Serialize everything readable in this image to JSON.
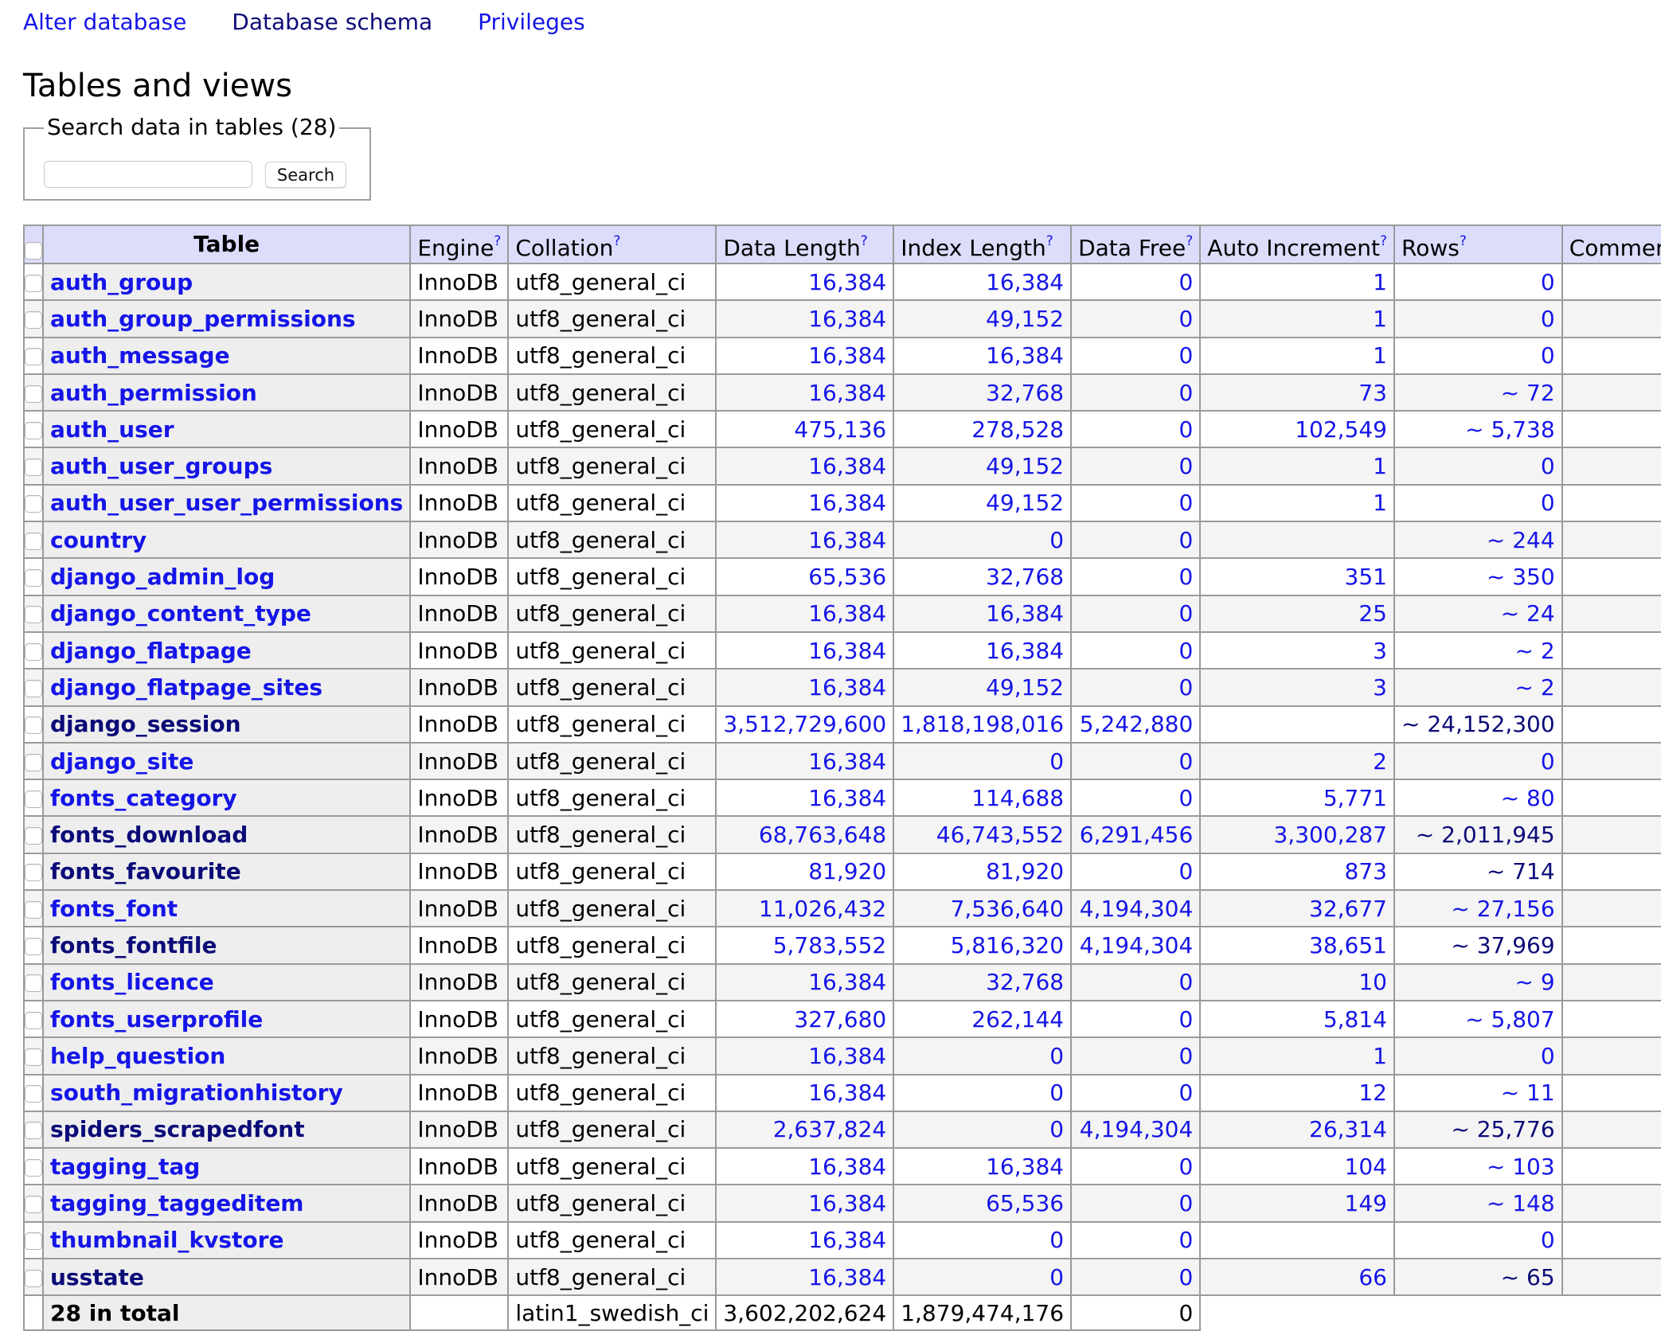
{
  "nav": {
    "links": [
      {
        "label": "Alter database",
        "visited": false
      },
      {
        "label": "Database schema",
        "visited": true
      },
      {
        "label": "Privileges",
        "visited": false
      }
    ]
  },
  "page_title": "Tables and views",
  "search": {
    "legend": "Search data in tables (28)",
    "input_value": "",
    "button_label": "Search"
  },
  "table": {
    "help_marker": "?",
    "columns": [
      {
        "label": "Table",
        "help": false
      },
      {
        "label": "Engine",
        "help": true
      },
      {
        "label": "Collation",
        "help": true
      },
      {
        "label": "Data Length",
        "help": true
      },
      {
        "label": "Index Length",
        "help": true
      },
      {
        "label": "Data Free",
        "help": true
      },
      {
        "label": "Auto Increment",
        "help": true
      },
      {
        "label": "Rows",
        "help": true
      },
      {
        "label": "Comment",
        "help": true
      }
    ],
    "rows": [
      {
        "name": "auth_group",
        "visited": false,
        "engine": "InnoDB",
        "collation": "utf8_general_ci",
        "data_length": "16,384",
        "index_length": "16,384",
        "data_free": "0",
        "auto_increment": "1",
        "rows": "0",
        "comment": ""
      },
      {
        "name": "auth_group_permissions",
        "visited": false,
        "engine": "InnoDB",
        "collation": "utf8_general_ci",
        "data_length": "16,384",
        "index_length": "49,152",
        "data_free": "0",
        "auto_increment": "1",
        "rows": "0",
        "comment": ""
      },
      {
        "name": "auth_message",
        "visited": false,
        "engine": "InnoDB",
        "collation": "utf8_general_ci",
        "data_length": "16,384",
        "index_length": "16,384",
        "data_free": "0",
        "auto_increment": "1",
        "rows": "0",
        "comment": ""
      },
      {
        "name": "auth_permission",
        "visited": false,
        "engine": "InnoDB",
        "collation": "utf8_general_ci",
        "data_length": "16,384",
        "index_length": "32,768",
        "data_free": "0",
        "auto_increment": "73",
        "rows": "~ 72",
        "comment": ""
      },
      {
        "name": "auth_user",
        "visited": false,
        "engine": "InnoDB",
        "collation": "utf8_general_ci",
        "data_length": "475,136",
        "index_length": "278,528",
        "data_free": "0",
        "auto_increment": "102,549",
        "rows": "~ 5,738",
        "comment": ""
      },
      {
        "name": "auth_user_groups",
        "visited": false,
        "engine": "InnoDB",
        "collation": "utf8_general_ci",
        "data_length": "16,384",
        "index_length": "49,152",
        "data_free": "0",
        "auto_increment": "1",
        "rows": "0",
        "comment": ""
      },
      {
        "name": "auth_user_user_permissions",
        "visited": false,
        "engine": "InnoDB",
        "collation": "utf8_general_ci",
        "data_length": "16,384",
        "index_length": "49,152",
        "data_free": "0",
        "auto_increment": "1",
        "rows": "0",
        "comment": ""
      },
      {
        "name": "country",
        "visited": false,
        "engine": "InnoDB",
        "collation": "utf8_general_ci",
        "data_length": "16,384",
        "index_length": "0",
        "data_free": "0",
        "auto_increment": "",
        "rows": "~ 244",
        "comment": ""
      },
      {
        "name": "django_admin_log",
        "visited": false,
        "engine": "InnoDB",
        "collation": "utf8_general_ci",
        "data_length": "65,536",
        "index_length": "32,768",
        "data_free": "0",
        "auto_increment": "351",
        "rows": "~ 350",
        "comment": ""
      },
      {
        "name": "django_content_type",
        "visited": false,
        "engine": "InnoDB",
        "collation": "utf8_general_ci",
        "data_length": "16,384",
        "index_length": "16,384",
        "data_free": "0",
        "auto_increment": "25",
        "rows": "~ 24",
        "comment": ""
      },
      {
        "name": "django_flatpage",
        "visited": false,
        "engine": "InnoDB",
        "collation": "utf8_general_ci",
        "data_length": "16,384",
        "index_length": "16,384",
        "data_free": "0",
        "auto_increment": "3",
        "rows": "~ 2",
        "comment": ""
      },
      {
        "name": "django_flatpage_sites",
        "visited": false,
        "engine": "InnoDB",
        "collation": "utf8_general_ci",
        "data_length": "16,384",
        "index_length": "49,152",
        "data_free": "0",
        "auto_increment": "3",
        "rows": "~ 2",
        "comment": ""
      },
      {
        "name": "django_session",
        "visited": true,
        "engine": "InnoDB",
        "collation": "utf8_general_ci",
        "data_length": "3,512,729,600",
        "index_length": "1,818,198,016",
        "data_free": "5,242,880",
        "auto_increment": "",
        "rows": "~ 24,152,300",
        "comment": ""
      },
      {
        "name": "django_site",
        "visited": false,
        "engine": "InnoDB",
        "collation": "utf8_general_ci",
        "data_length": "16,384",
        "index_length": "0",
        "data_free": "0",
        "auto_increment": "2",
        "rows": "0",
        "comment": ""
      },
      {
        "name": "fonts_category",
        "visited": false,
        "engine": "InnoDB",
        "collation": "utf8_general_ci",
        "data_length": "16,384",
        "index_length": "114,688",
        "data_free": "0",
        "auto_increment": "5,771",
        "rows": "~ 80",
        "comment": ""
      },
      {
        "name": "fonts_download",
        "visited": true,
        "engine": "InnoDB",
        "collation": "utf8_general_ci",
        "data_length": "68,763,648",
        "index_length": "46,743,552",
        "data_free": "6,291,456",
        "auto_increment": "3,300,287",
        "rows": "~ 2,011,945",
        "comment": ""
      },
      {
        "name": "fonts_favourite",
        "visited": true,
        "engine": "InnoDB",
        "collation": "utf8_general_ci",
        "data_length": "81,920",
        "index_length": "81,920",
        "data_free": "0",
        "auto_increment": "873",
        "rows": "~ 714",
        "comment": ""
      },
      {
        "name": "fonts_font",
        "visited": false,
        "engine": "InnoDB",
        "collation": "utf8_general_ci",
        "data_length": "11,026,432",
        "index_length": "7,536,640",
        "data_free": "4,194,304",
        "auto_increment": "32,677",
        "rows": "~ 27,156",
        "comment": ""
      },
      {
        "name": "fonts_fontfile",
        "visited": true,
        "engine": "InnoDB",
        "collation": "utf8_general_ci",
        "data_length": "5,783,552",
        "index_length": "5,816,320",
        "data_free": "4,194,304",
        "auto_increment": "38,651",
        "rows": "~ 37,969",
        "comment": ""
      },
      {
        "name": "fonts_licence",
        "visited": false,
        "engine": "InnoDB",
        "collation": "utf8_general_ci",
        "data_length": "16,384",
        "index_length": "32,768",
        "data_free": "0",
        "auto_increment": "10",
        "rows": "~ 9",
        "comment": ""
      },
      {
        "name": "fonts_userprofile",
        "visited": false,
        "engine": "InnoDB",
        "collation": "utf8_general_ci",
        "data_length": "327,680",
        "index_length": "262,144",
        "data_free": "0",
        "auto_increment": "5,814",
        "rows": "~ 5,807",
        "comment": ""
      },
      {
        "name": "help_question",
        "visited": false,
        "engine": "InnoDB",
        "collation": "utf8_general_ci",
        "data_length": "16,384",
        "index_length": "0",
        "data_free": "0",
        "auto_increment": "1",
        "rows": "0",
        "comment": ""
      },
      {
        "name": "south_migrationhistory",
        "visited": false,
        "engine": "InnoDB",
        "collation": "utf8_general_ci",
        "data_length": "16,384",
        "index_length": "0",
        "data_free": "0",
        "auto_increment": "12",
        "rows": "~ 11",
        "comment": ""
      },
      {
        "name": "spiders_scrapedfont",
        "visited": true,
        "engine": "InnoDB",
        "collation": "utf8_general_ci",
        "data_length": "2,637,824",
        "index_length": "0",
        "data_free": "4,194,304",
        "auto_increment": "26,314",
        "rows": "~ 25,776",
        "comment": ""
      },
      {
        "name": "tagging_tag",
        "visited": false,
        "engine": "InnoDB",
        "collation": "utf8_general_ci",
        "data_length": "16,384",
        "index_length": "16,384",
        "data_free": "0",
        "auto_increment": "104",
        "rows": "~ 103",
        "comment": ""
      },
      {
        "name": "tagging_taggeditem",
        "visited": false,
        "engine": "InnoDB",
        "collation": "utf8_general_ci",
        "data_length": "16,384",
        "index_length": "65,536",
        "data_free": "0",
        "auto_increment": "149",
        "rows": "~ 148",
        "comment": ""
      },
      {
        "name": "thumbnail_kvstore",
        "visited": false,
        "engine": "InnoDB",
        "collation": "utf8_general_ci",
        "data_length": "16,384",
        "index_length": "0",
        "data_free": "0",
        "auto_increment": "",
        "rows": "0",
        "comment": ""
      },
      {
        "name": "usstate",
        "visited": true,
        "engine": "InnoDB",
        "collation": "utf8_general_ci",
        "data_length": "16,384",
        "index_length": "0",
        "data_free": "0",
        "auto_increment": "66",
        "rows": "~ 65",
        "comment": ""
      }
    ],
    "footer": {
      "label": "28 in total",
      "engine": "",
      "collation": "latin1_swedish_ci",
      "data_length": "3,602,202,624",
      "index_length": "1,879,474,176",
      "data_free": "0"
    }
  },
  "colors": {
    "link": "#1515e8",
    "visited_link": "#0b0b78",
    "header_bg": "#dcdcfb",
    "name_col_bg": "#eeeeee",
    "alt_row_bg": "#f4f4f4",
    "border": "#9a9a9a"
  }
}
